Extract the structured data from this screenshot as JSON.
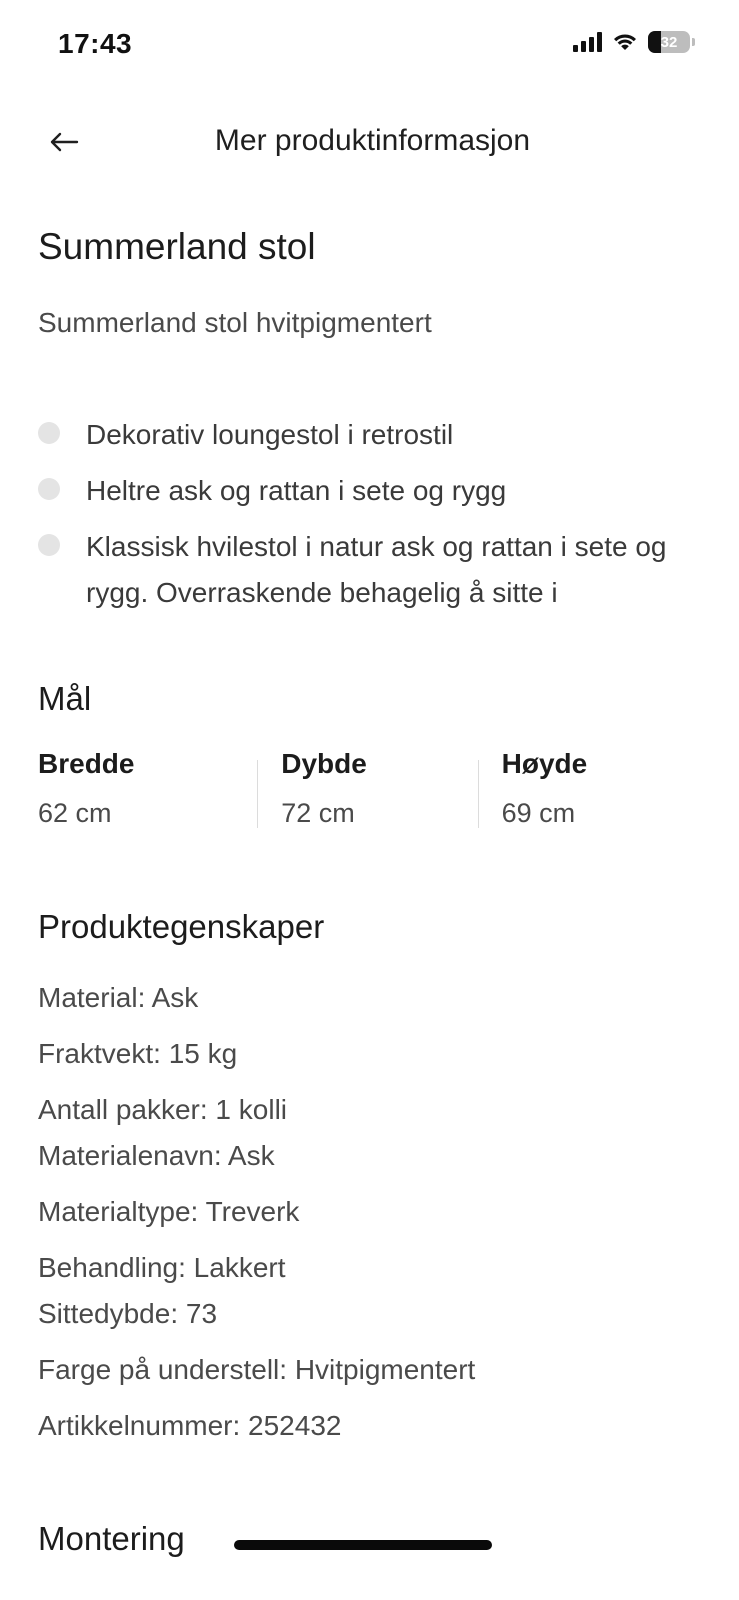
{
  "status_bar": {
    "time": "17:43",
    "battery": "32"
  },
  "header": {
    "title": "Mer produktinformasjon",
    "back_icon": "arrow-left-icon"
  },
  "product": {
    "title": "Summerland stol",
    "subtitle": "Summerland stol hvitpigmentert",
    "features": [
      "Dekorativ loungestol i retrostil",
      "Heltre ask og rattan i sete og rygg",
      "Klassisk hvilestol i natur ask og rattan i sete og rygg. Overraskende behagelig å sitte i"
    ]
  },
  "dimensions": {
    "title": "Mål",
    "items": [
      {
        "label": "Bredde",
        "value": "62 cm"
      },
      {
        "label": "Dybde",
        "value": "72 cm"
      },
      {
        "label": "Høyde",
        "value": "69 cm"
      }
    ]
  },
  "properties": {
    "title": "Produktegenskaper",
    "items": [
      "Material: Ask",
      "Fraktvekt: 15 kg",
      "Antall pakker: 1 kolli",
      "Materialenavn: Ask",
      "Materialtype: Treverk",
      "Behandling: Lakkert",
      "Sittedybde: 73",
      "Farge på understell: Hvitpigmentert",
      "Artikkelnummer: 252432"
    ]
  },
  "assembly": {
    "title": "Montering"
  }
}
